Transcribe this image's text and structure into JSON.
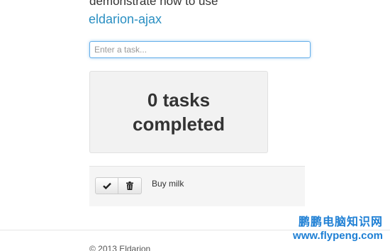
{
  "intro": {
    "text": "demonstrate how to use",
    "link": "eldarion-ajax"
  },
  "task_input": {
    "placeholder": "Enter a task..."
  },
  "summary": {
    "line1": "0 tasks",
    "line2": "completed"
  },
  "tasks": [
    {
      "label": "Buy milk",
      "complete_icon": "check-icon",
      "delete_icon": "trash-icon"
    }
  ],
  "footer": {
    "text": "© 2013 Eldarion"
  },
  "watermark": {
    "chinese": "鹏鹏电脑知识网",
    "url": "www.flypeng.com",
    "color": "#1e7fd4"
  },
  "colors": {
    "link": "#2a8fc2",
    "input_focus_border": "#66afe9",
    "summary_bg": "#f2f2f2"
  }
}
